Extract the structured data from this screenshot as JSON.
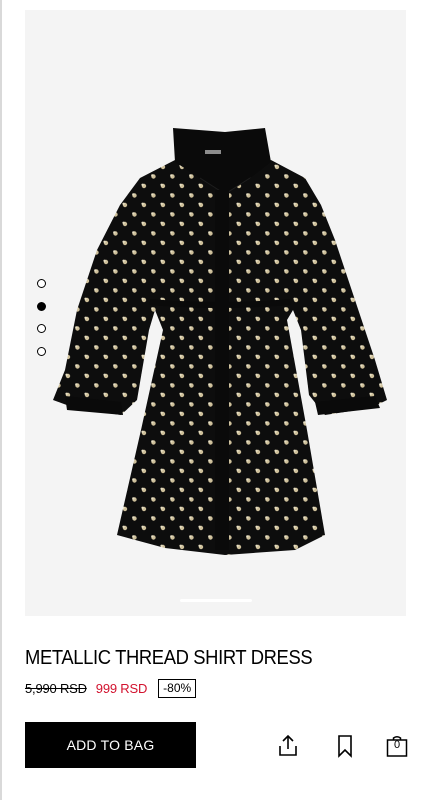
{
  "product": {
    "image_alt": "dress-photo",
    "carousel": {
      "dot_count": 4,
      "active_index": 1
    },
    "title": "METALLIC THREAD SHIRT DRESS",
    "price_original": "5,990 RSD",
    "price_sale": "999 RSD",
    "discount": "-80%"
  },
  "actions": {
    "add_to_bag_label": "ADD TO BAG",
    "share_icon": "share-icon",
    "bookmark_icon": "bookmark-icon",
    "bag_icon": "shopping-bag-icon",
    "bag_count": "0"
  },
  "colors": {
    "sale_price": "#d2122e",
    "button_bg": "#000000",
    "image_bg": "#f4f4f4"
  }
}
